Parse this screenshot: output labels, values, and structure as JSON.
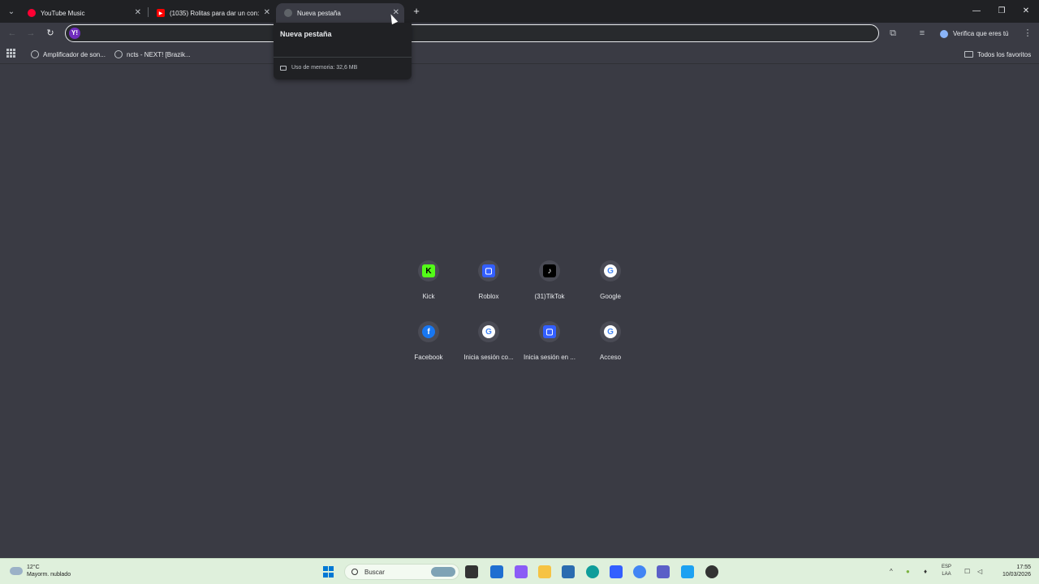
{
  "tabs": [
    {
      "title": "YouTube Music",
      "favicon_color": "#ff0033",
      "active": false
    },
    {
      "title": "(1035) Rolitas para dar un con:",
      "favicon_color": "#ff0000",
      "active": false
    },
    {
      "title": "Nueva pestaña",
      "favicon_color": "#5f6368",
      "active": true
    }
  ],
  "window_controls": {
    "minimize": "—",
    "restore": "❐",
    "close": "✕"
  },
  "toolbar": {
    "back": "←",
    "forward": "→",
    "reload": "↻",
    "omnibox_value": "",
    "verify_label": "Verifica que eres tú"
  },
  "bookmarks": {
    "items": [
      {
        "label": "Amplificador de son..."
      },
      {
        "label": "ncts - NEXT! [Brazik..."
      }
    ],
    "all_favorites": "Todos los favoritos"
  },
  "hovercard": {
    "title": "Nueva pestaña",
    "memory": "Uso de memoria: 32,6 MB"
  },
  "shortcuts": [
    {
      "label": "Kick",
      "icon": "K",
      "bg": "#53fc18",
      "fg": "#000000"
    },
    {
      "label": "Roblox",
      "icon": "▢",
      "bg": "#335fff",
      "fg": "#ffffff"
    },
    {
      "label": "(31)TikTok",
      "icon": "♪",
      "bg": "#000000",
      "fg": "#ffffff"
    },
    {
      "label": "Google",
      "icon": "G",
      "bg": "#ffffff",
      "fg": "#4285f4"
    },
    {
      "label": "Facebook",
      "icon": "f",
      "bg": "#1877f2",
      "fg": "#ffffff"
    },
    {
      "label": "Inicia sesión co...",
      "icon": "G",
      "bg": "#ffffff",
      "fg": "#4285f4"
    },
    {
      "label": "Inicia sesión en ...",
      "icon": "▢",
      "bg": "#335fff",
      "fg": "#ffffff"
    },
    {
      "label": "Acceso",
      "icon": "G",
      "bg": "#ffffff",
      "fg": "#4285f4"
    }
  ],
  "taskbar": {
    "weather_temp": "12°C",
    "weather_desc": "Mayorm. nublado",
    "search_label": "Buscar",
    "lang_1": "ESP",
    "lang_2": "LAA",
    "time": "17:55",
    "date": "10/03/2026"
  }
}
